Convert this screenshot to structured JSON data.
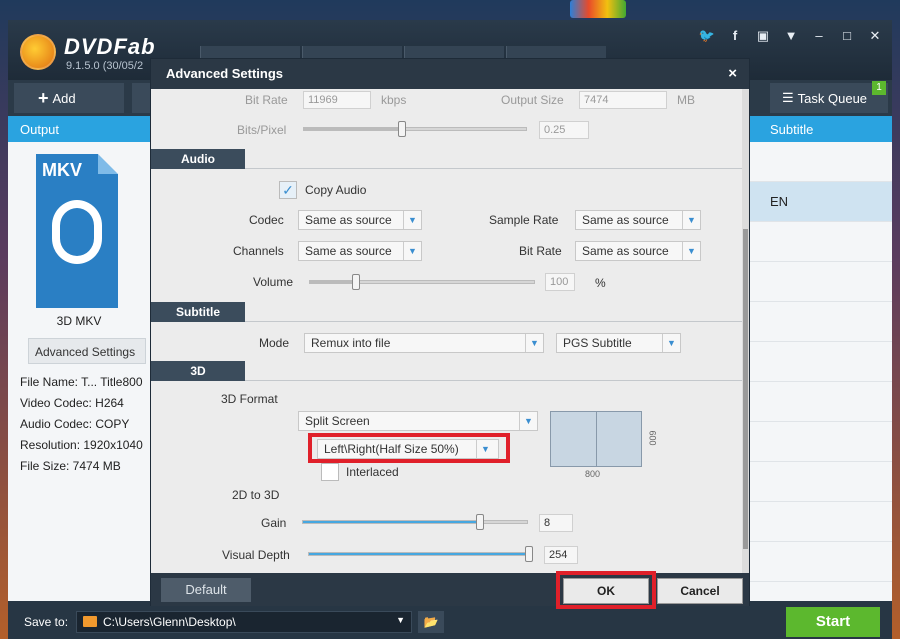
{
  "app": {
    "name": "DVDFab",
    "version": "9.1.5.0 (30/05/2",
    "add_label": "Add",
    "task_queue_label": "Task Queue",
    "task_queue_count": "1"
  },
  "left_panel": {
    "header": "Output",
    "file_type": "MKV",
    "profile_name": "3D MKV",
    "advanced_button": "Advanced Settings",
    "info": {
      "file_name": "File Name: T... Title800",
      "video_codec": "Video Codec: H264",
      "audio_codec": "Audio Codec: COPY",
      "resolution": "Resolution: 1920x1040",
      "file_size": "File Size: 7474 MB"
    }
  },
  "right_panel": {
    "header": "Subtitle",
    "rows": [
      "",
      "EN",
      "",
      "",
      "",
      "",
      "",
      "",
      "",
      "",
      ""
    ]
  },
  "bottom": {
    "save_label": "Save to:",
    "save_path": "C:\\Users\\Glenn\\Desktop\\",
    "start_label": "Start"
  },
  "dialog": {
    "title": "Advanced Settings",
    "close": "×",
    "video": {
      "bitrate_label": "Bit Rate",
      "bitrate_value": "11969",
      "bitrate_unit": "kbps",
      "output_size_label": "Output Size",
      "output_size_value": "7474",
      "output_size_unit": "MB",
      "bits_pixel_label": "Bits/Pixel",
      "bits_pixel_value": "0.25"
    },
    "audio": {
      "section": "Audio",
      "copy_audio_label": "Copy Audio",
      "copy_audio_checked": true,
      "codec_label": "Codec",
      "codec_value": "Same as source",
      "sample_rate_label": "Sample Rate",
      "sample_rate_value": "Same as source",
      "channels_label": "Channels",
      "channels_value": "Same as source",
      "bit_rate_label": "Bit Rate",
      "bit_rate_value": "Same as source",
      "volume_label": "Volume",
      "volume_value": "100",
      "volume_unit": "%"
    },
    "subtitle": {
      "section": "Subtitle",
      "mode_label": "Mode",
      "mode_value": "Remux into file",
      "format_value": "PGS Subtitle"
    },
    "threed": {
      "section": "3D",
      "format_label": "3D Format",
      "format_value": "Split Screen",
      "layout_value": "Left\\Right(Half Size 50%)",
      "interlaced_label": "Interlaced",
      "preview_width": "800",
      "preview_height": "600",
      "two_to_three_label": "2D to 3D",
      "gain_label": "Gain",
      "gain_value": "8",
      "visual_depth_label": "Visual Depth",
      "visual_depth_value": "254"
    },
    "buttons": {
      "default": "Default",
      "ok": "OK",
      "cancel": "Cancel"
    }
  },
  "colors": {
    "accent_blue": "#2aa3e0",
    "highlight_red": "#e0202a",
    "start_green": "#5cb82e",
    "dark_chrome": "#2b3845"
  }
}
